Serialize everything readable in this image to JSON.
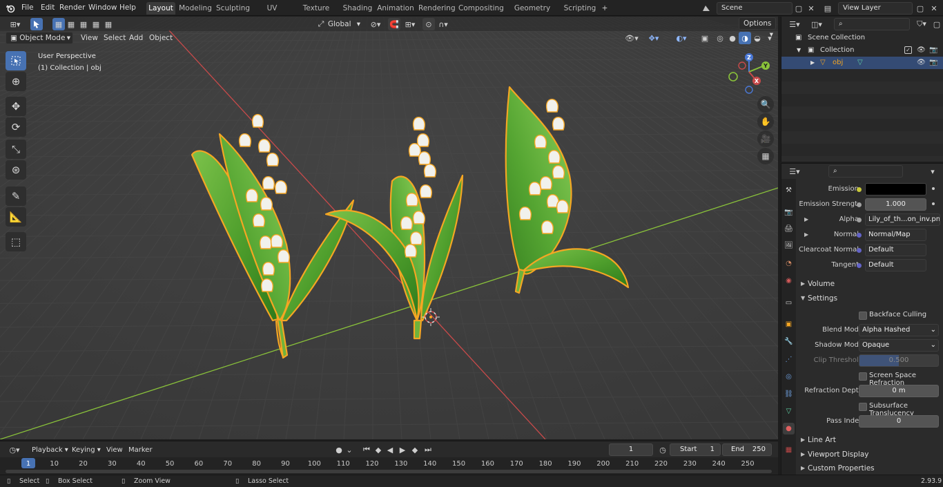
{
  "menu": {
    "items": [
      "File",
      "Edit",
      "Render",
      "Window",
      "Help"
    ],
    "workspaces": [
      "Layout",
      "Modeling",
      "Sculpting",
      "UV Editing",
      "Texture Paint",
      "Shading",
      "Animation",
      "Rendering",
      "Compositing",
      "Geometry Nodes",
      "Scripting"
    ],
    "active_workspace": "Layout",
    "add_tab": "+",
    "scene_name": "Scene",
    "view_layer": "View Layer"
  },
  "viewport": {
    "mode": "Object Mode",
    "menus": [
      "View",
      "Select",
      "Add",
      "Object"
    ],
    "transform_orientation": "Global",
    "options_label": "Options",
    "perspective_label": "User Perspective",
    "collection_label": "(1) Collection | obj",
    "gizmo_axes": [
      "X",
      "Y",
      "Z"
    ]
  },
  "outliner": {
    "search_placeholder": "",
    "rows": [
      "Scene Collection",
      "Collection",
      "obj"
    ]
  },
  "properties": {
    "search_placeholder": "",
    "rows": {
      "emission": {
        "label": "Emission",
        "value": ""
      },
      "emission_strength": {
        "label": "Emission Strengt",
        "value": "1.000"
      },
      "alpha": {
        "label": "Alpha",
        "value": "Lily_of_th...on_inv.png"
      },
      "normal": {
        "label": "Normal",
        "value": "Normal/Map"
      },
      "clearcoat_normal": {
        "label": "Clearcoat Normal",
        "value": "Default"
      },
      "tangent": {
        "label": "Tangent",
        "value": "Default"
      }
    },
    "sections": {
      "volume": "Volume",
      "settings": "Settings",
      "line_art": "Line Art",
      "viewport_display": "Viewport Display",
      "custom_properties": "Custom Properties"
    },
    "settings": {
      "backface_culling": "Backface Culling",
      "blend_mode_label": "Blend Mode",
      "blend_mode_value": "Alpha Hashed",
      "shadow_mode_label": "Shadow Mode",
      "shadow_mode_value": "Opaque",
      "clip_threshold_label": "Clip Threshold",
      "clip_threshold_value": "0.500",
      "clip_threshold_fraction": 0.5,
      "ssr_label": "Screen Space Refraction",
      "refraction_depth_label": "Refraction Depth",
      "refraction_depth_value": "0 m",
      "sss_label": "Subsurface Translucency",
      "pass_index_label": "Pass Index",
      "pass_index_value": "0"
    }
  },
  "timeline": {
    "menus": [
      "Playback",
      "Keying",
      "View",
      "Marker"
    ],
    "current_frame": "1",
    "start_label": "Start",
    "start_value": "1",
    "end_label": "End",
    "end_value": "250",
    "ruler": [
      "1",
      "10",
      "20",
      "30",
      "40",
      "50",
      "60",
      "70",
      "80",
      "90",
      "100",
      "110",
      "120",
      "130",
      "140",
      "150",
      "160",
      "170",
      "180",
      "190",
      "200",
      "210",
      "220",
      "230",
      "240",
      "250"
    ]
  },
  "status": {
    "select": "Select",
    "box_select": "Box Select",
    "zoom_view": "Zoom View",
    "lasso_select": "Lasso Select",
    "version": "2.93.9"
  },
  "colors": {
    "accent": "#4772b3",
    "selection_outline": "#f5a623",
    "leaf_green": "#4ea12e",
    "x_axis": "#c94a4a",
    "y_axis": "#8ac33a",
    "z_axis": "#4a78d6"
  }
}
